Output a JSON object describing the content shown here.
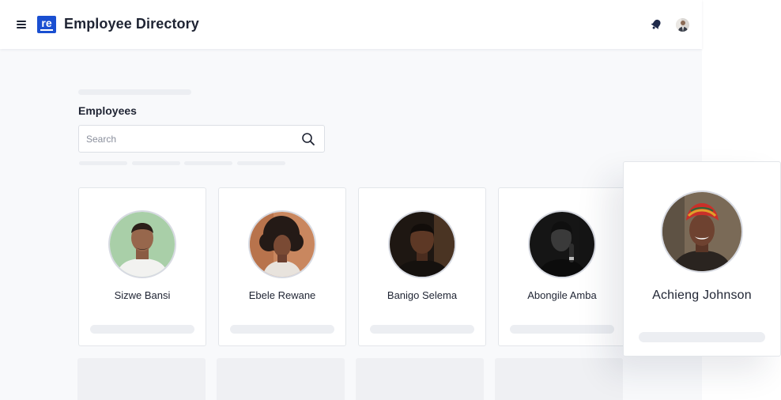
{
  "header": {
    "logo_text": "re",
    "title": "Employee Directory",
    "menu_icon": "hamburger-icon",
    "notification_icon": "bell-icon",
    "brand_color": "#1a4fd1"
  },
  "main": {
    "section_title": "Employees",
    "search": {
      "placeholder": "Search",
      "value": "",
      "icon": "search-icon"
    }
  },
  "employees": [
    {
      "name": "Sizwe Bansi"
    },
    {
      "name": "Ebele Rewane"
    },
    {
      "name": "Banigo Selema"
    },
    {
      "name": "Abongile Amba"
    }
  ],
  "featured_employee": {
    "name": "Achieng Johnson"
  }
}
